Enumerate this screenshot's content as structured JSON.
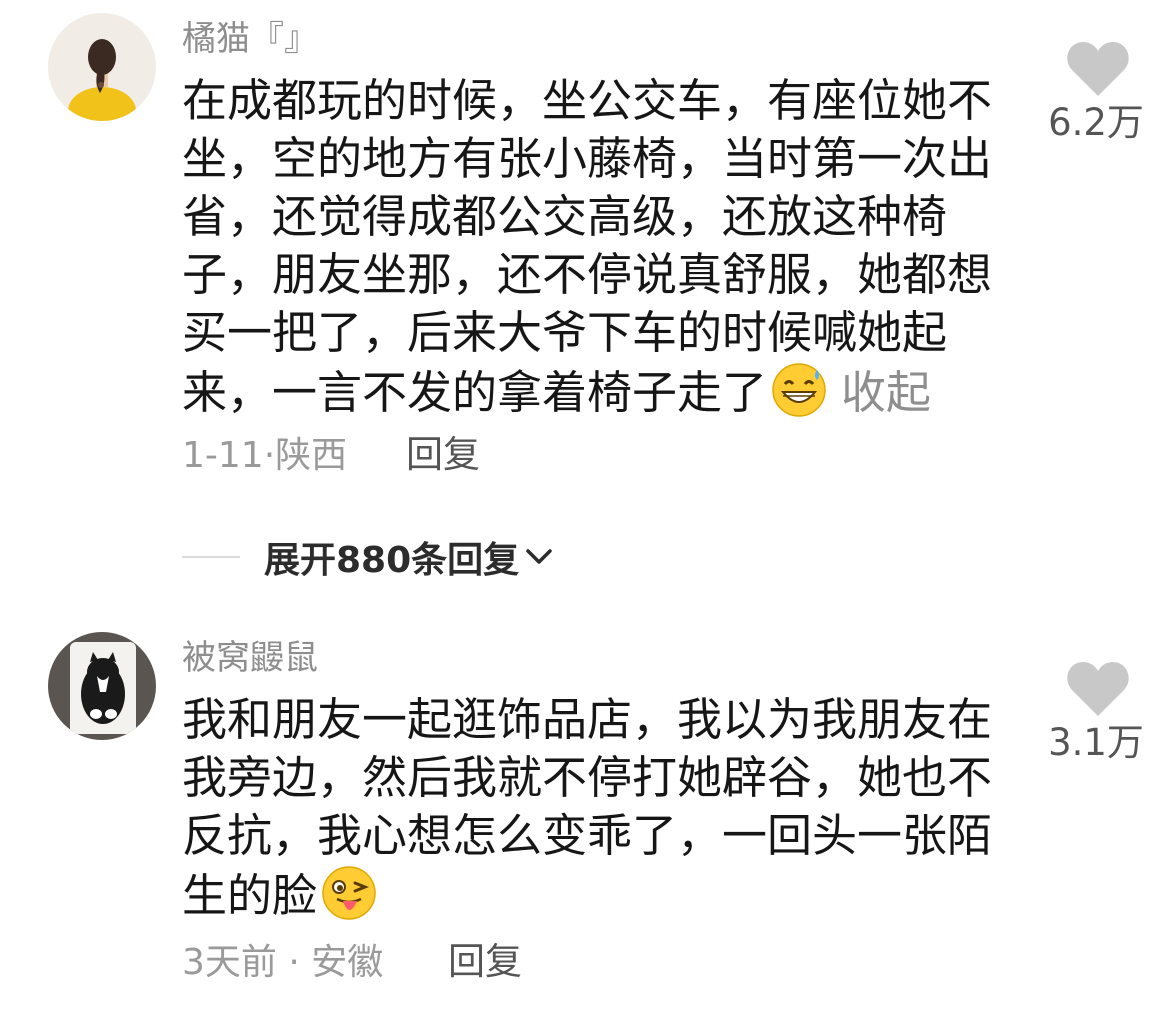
{
  "comments": [
    {
      "username": "橘猫『』",
      "avatar_icon": "girl-yellow-shirt-avatar",
      "text": "在成都玩的时候，坐公交车，有座位她不坐，空的地方有张小藤椅，当时第一次出省，还觉得成都公交高级，还放这种椅子，朋友坐那，还不停说真舒服，她都想买一把了，后来大爷下车的时候喊她起来，一言不发的拿着椅子走了",
      "emoji_icon": "grinning-sweat-emoji",
      "collapse_label": "收起",
      "date": "1-11",
      "location": "陕西",
      "reply_label": "回复",
      "likes": "6.2万"
    },
    {
      "username": "被窝鼹鼠",
      "avatar_icon": "tuxedo-cat-avatar",
      "text": "我和朋友一起逛饰品店，我以为我朋友在我旁边，然后我就不停打她辟谷，她也不反抗，我心想怎么变乖了，一回头一张陌生的脸",
      "emoji_icon": "winking-tongue-emoji",
      "date": "3天前",
      "location": "安徽",
      "reply_label": "回复",
      "likes": "3.1万"
    }
  ],
  "expand_replies": {
    "label": "展开880条回复",
    "icon": "chevron-down-icon"
  },
  "colors": {
    "text": "#161616",
    "muted": "#8e8e8e",
    "heart": "#c8c8c8"
  }
}
